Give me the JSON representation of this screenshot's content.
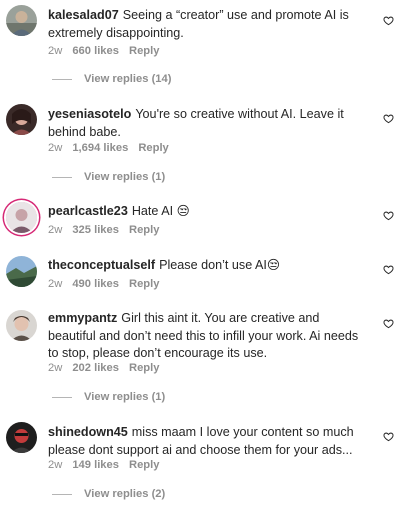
{
  "comments": [
    {
      "username": "kalesalad07",
      "text": "Seeing a “creator” use and promote AI is extremely disappointing.",
      "time": "2w",
      "likes": "660 likes",
      "reply": "Reply",
      "view_replies": "View replies (14)",
      "avatar_icon": "user-avatar-icon"
    },
    {
      "username": "yeseniasotelo",
      "text": "You're so creative without AI. Leave it behind babe.",
      "time": "2w",
      "likes": "1,694 likes",
      "reply": "Reply",
      "view_replies": "View replies (1)",
      "avatar_icon": "user-avatar-icon"
    },
    {
      "username": "pearlcastle23",
      "text": "Hate AI 😒",
      "time": "2w",
      "likes": "325 likes",
      "reply": "Reply",
      "avatar_icon": "user-avatar-icon"
    },
    {
      "username": "theconceptualself",
      "text": "Please don’t use AI😒",
      "time": "2w",
      "likes": "490 likes",
      "reply": "Reply",
      "avatar_icon": "user-avatar-icon"
    },
    {
      "username": "emmypantz",
      "text": "Girl this aint it. You are creative and beautiful and don’t need this to infill your work. Ai needs to stop, please don’t encourage its use.",
      "time": "2w",
      "likes": "202 likes",
      "reply": "Reply",
      "view_replies": "View replies (1)",
      "avatar_icon": "user-avatar-icon"
    },
    {
      "username": "shinedown45",
      "text": "miss maam I love your content so much please dont support ai and choose them for your ads...",
      "time": "2w",
      "likes": "149 likes",
      "reply": "Reply",
      "view_replies": "View replies (2)",
      "avatar_icon": "user-avatar-icon"
    }
  ],
  "colors": {
    "text": "#262626",
    "secondary": "#8e8e8e",
    "story_ring": "#d62976"
  }
}
